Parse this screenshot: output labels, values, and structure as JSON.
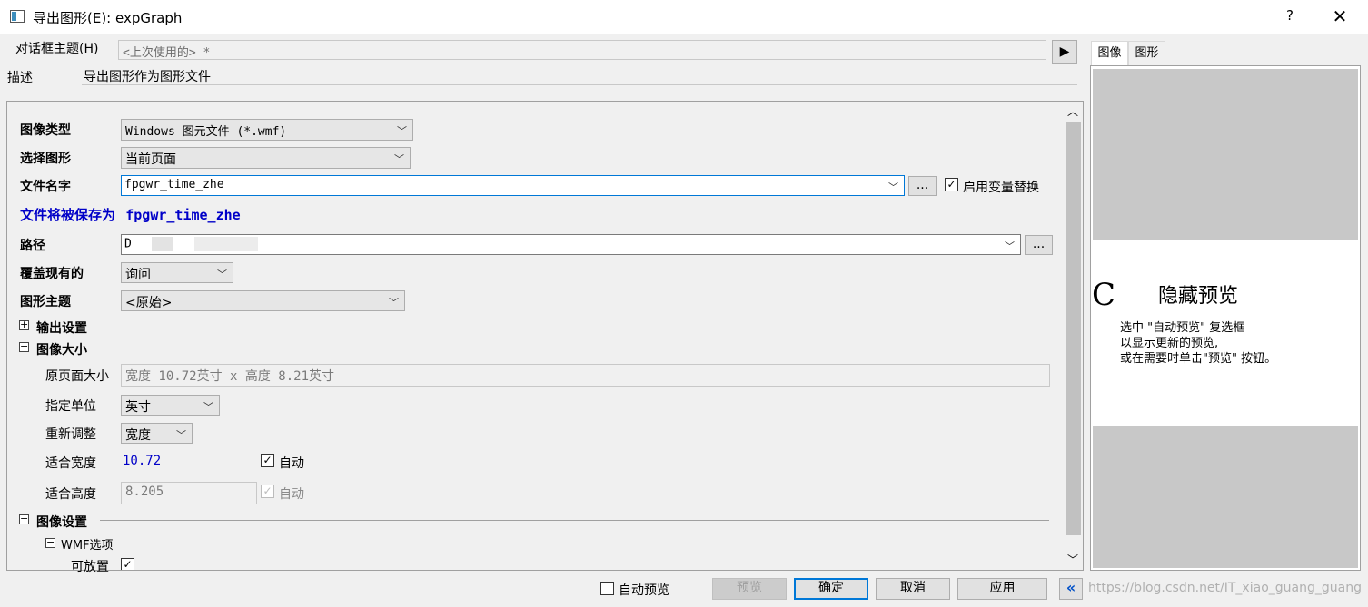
{
  "window": {
    "title": "导出图形(E): expGraph",
    "help": "?",
    "close": "✕"
  },
  "dialog_theme": {
    "label": "对话框主题(H)",
    "value": "<上次使用的> *"
  },
  "description": {
    "label": "描述",
    "value": "导出图形作为图形文件"
  },
  "form": {
    "image_type": {
      "label": "图像类型",
      "value": "Windows 图元文件 (*.wmf)"
    },
    "select_graph": {
      "label": "选择图形",
      "value": "当前页面"
    },
    "file_name": {
      "label": "文件名字",
      "value": "fpgwr_time_zhe",
      "browse": "...",
      "enable_var_label": "启用变量替换",
      "enable_var_checked": "✓"
    },
    "saved_as": {
      "prefix": "文件将被保存为",
      "name": "fpgwr_time_zhe"
    },
    "path": {
      "label": "路径",
      "value": "D",
      "browse": "..."
    },
    "overwrite": {
      "label": "覆盖现有的",
      "value": "询问"
    },
    "graph_theme": {
      "label": "图形主题",
      "value": "<原始>"
    },
    "output_settings": {
      "label": "输出设置",
      "toggle": "+"
    },
    "image_size": {
      "label": "图像大小",
      "toggle": "−",
      "orig_page_size_label": "原页面大小",
      "orig_page_size_value": "宽度 10.72英寸 x 高度 8.21英寸",
      "unit_label": "指定单位",
      "unit_value": "英寸",
      "rescale_label": "重新调整",
      "rescale_value": "宽度",
      "fit_width_label": "适合宽度",
      "fit_width_value": "10.72",
      "fit_width_auto": "自动",
      "fit_width_auto_checked": "✓",
      "fit_height_label": "适合高度",
      "fit_height_value": "8.205",
      "fit_height_auto": "自动",
      "fit_height_auto_checked": "✓"
    },
    "image_settings": {
      "label": "图像设置",
      "toggle": "−",
      "wmf_label": "WMF选项",
      "wmf_toggle": "−",
      "placeable_label": "可放置",
      "placeable_checked": "✓"
    }
  },
  "preview": {
    "tabs": [
      "图像",
      "图形"
    ],
    "glyph": "C",
    "title": "隐藏预览",
    "line1": "选中 \"自动预览\" 复选框",
    "line2": "以显示更新的预览,",
    "line3": "或在需要时单击\"预览\" 按钮。"
  },
  "footer": {
    "auto_preview": "自动预览",
    "preview_btn": "预览",
    "ok_btn": "确定",
    "cancel_btn": "取消",
    "apply_btn": "应用",
    "collapse_btn": "«",
    "watermark": "https://blog.csdn.net/IT_xiao_guang_guang"
  },
  "colors": {
    "accent_blue": "#0000c8",
    "focus_border": "#0078d7",
    "window_bg": "#f0f0f0"
  }
}
